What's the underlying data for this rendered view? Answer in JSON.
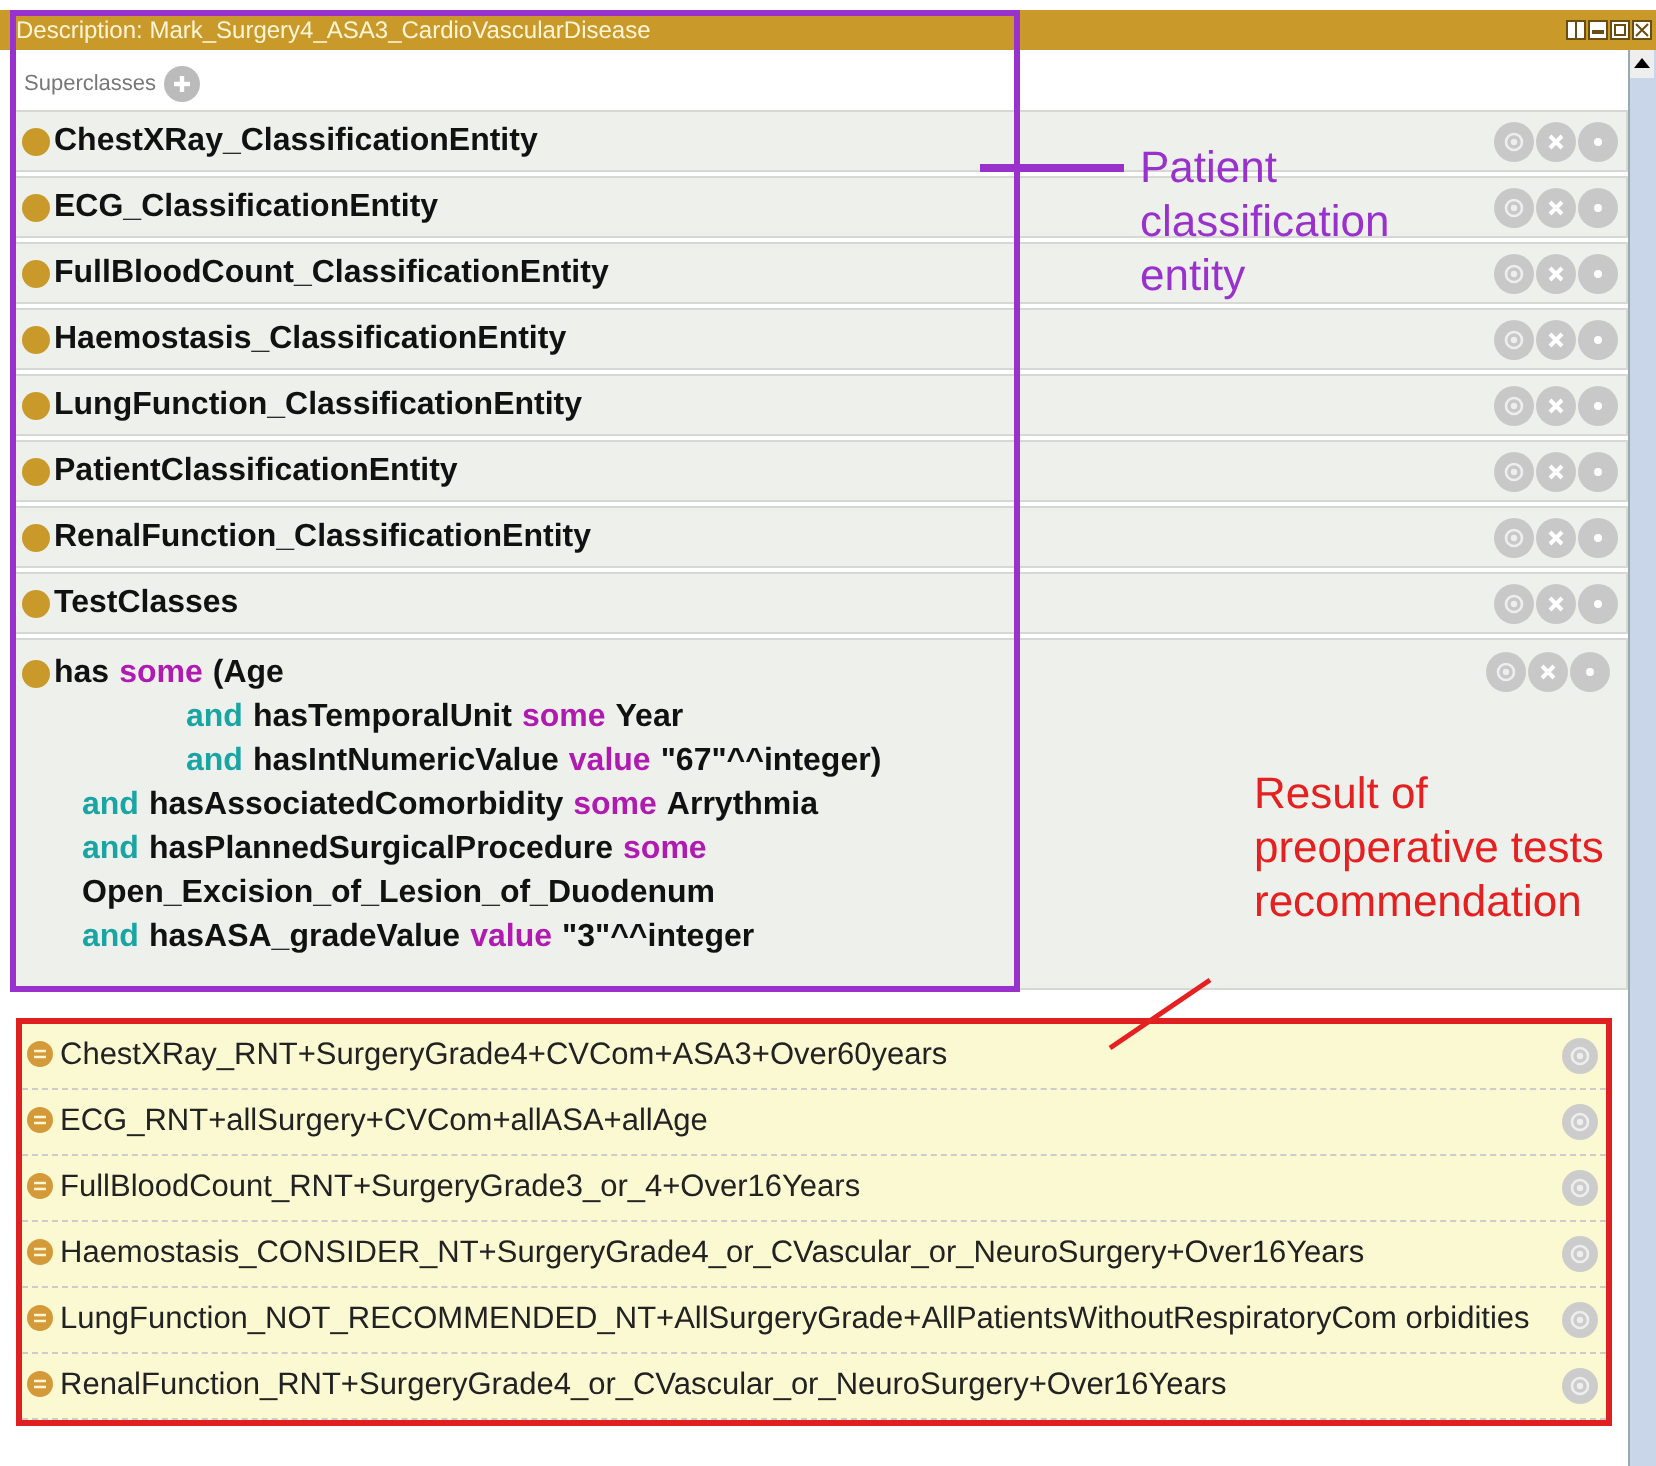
{
  "window": {
    "title": "Description: Mark_Surgery4_ASA3_CardioVascularDisease"
  },
  "superclasses": {
    "label": "Superclasses",
    "items": [
      {
        "label": "ChestXRay_ClassificationEntity"
      },
      {
        "label": "ECG_ClassificationEntity"
      },
      {
        "label": "FullBloodCount_ClassificationEntity"
      },
      {
        "label": "Haemostasis_ClassificationEntity"
      },
      {
        "label": "LungFunction_ClassificationEntity"
      },
      {
        "label": "PatientClassificationEntity"
      },
      {
        "label": "RenalFunction_ClassificationEntity"
      },
      {
        "label": "TestClasses"
      }
    ],
    "expression": [
      {
        "kind": "first",
        "tokens": [
          {
            "text": "has",
            "kind": "name"
          },
          {
            "text": "some",
            "kind": "keyword"
          },
          {
            "text": "(Age",
            "kind": "name"
          }
        ]
      },
      {
        "kind": "inner",
        "tokens": [
          {
            "text": "and",
            "kind": "connective"
          },
          {
            "text": "hasTemporalUnit",
            "kind": "name"
          },
          {
            "text": "some",
            "kind": "keyword"
          },
          {
            "text": "Year",
            "kind": "name"
          }
        ]
      },
      {
        "kind": "inner",
        "tokens": [
          {
            "text": "and",
            "kind": "connective"
          },
          {
            "text": "hasIntNumericValue",
            "kind": "name"
          },
          {
            "text": "value",
            "kind": "keyword"
          },
          {
            "text": "\"67\"^^integer)",
            "kind": "name"
          }
        ]
      },
      {
        "kind": "outer",
        "tokens": [
          {
            "text": "and",
            "kind": "connective"
          },
          {
            "text": "hasAssociatedComorbidity",
            "kind": "name"
          },
          {
            "text": "some",
            "kind": "keyword"
          },
          {
            "text": "Arrythmia",
            "kind": "name"
          }
        ]
      },
      {
        "kind": "outer",
        "tokens": [
          {
            "text": "and",
            "kind": "connective"
          },
          {
            "text": "hasPlannedSurgicalProcedure",
            "kind": "name"
          },
          {
            "text": "some",
            "kind": "keyword"
          }
        ]
      },
      {
        "kind": "outer",
        "tokens": [
          {
            "text": "Open_Excision_of_Lesion_of_Duodenum",
            "kind": "name"
          }
        ]
      },
      {
        "kind": "outer",
        "tokens": [
          {
            "text": "and",
            "kind": "connective"
          },
          {
            "text": "hasASA_gradeValue",
            "kind": "name"
          },
          {
            "text": "value",
            "kind": "keyword"
          },
          {
            "text": "\"3\"^^integer",
            "kind": "name"
          }
        ]
      }
    ]
  },
  "inferred": [
    {
      "label": "ChestXRay_RNT+SurgeryGrade4+CVCom+ASA3+Over60years"
    },
    {
      "label": "ECG_RNT+allSurgery+CVCom+allASA+allAge"
    },
    {
      "label": "FullBloodCount_RNT+SurgeryGrade3_or_4+Over16Years"
    },
    {
      "label": "Haemostasis_CONSIDER_NT+SurgeryGrade4_or_CVascular_or_NeuroSurgery+Over16Years"
    },
    {
      "label": "LungFunction_NOT_RECOMMENDED_NT+AllSurgeryGrade+AllPatientsWithoutRespiratoryCom orbidities"
    },
    {
      "label": "RenalFunction_RNT+SurgeryGrade4_or_CVascular_or_NeuroSurgery+Over16Years"
    }
  ],
  "annotations": [
    {
      "kind": "purple",
      "text": "Patient classification entity"
    },
    {
      "kind": "red",
      "text": "Result of preoperative tests recommendation"
    }
  ]
}
